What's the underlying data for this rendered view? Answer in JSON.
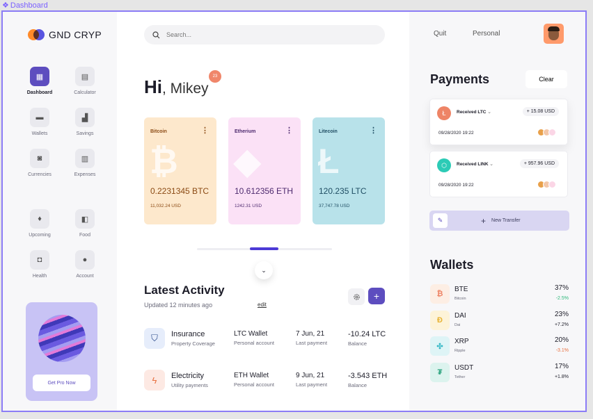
{
  "frame_label": "Dashboard",
  "brand": {
    "name": "GND CRYP"
  },
  "nav": {
    "group1": [
      {
        "label": "Dashboard",
        "icon": "dashboard-icon",
        "glyph": "▦",
        "active": true
      },
      {
        "label": "Calculator",
        "icon": "calculator-icon",
        "glyph": "▤",
        "active": false
      },
      {
        "label": "Wallets",
        "icon": "wallet-icon",
        "glyph": "▬",
        "active": false
      },
      {
        "label": "Savings",
        "icon": "savings-icon",
        "glyph": "▟",
        "active": false
      },
      {
        "label": "Currencies",
        "icon": "currencies-icon",
        "glyph": "◙",
        "active": false
      },
      {
        "label": "Expenses",
        "icon": "expenses-icon",
        "glyph": "▥",
        "active": false
      }
    ],
    "group2": [
      {
        "label": "Upcoming",
        "icon": "fire-icon",
        "glyph": "♦",
        "active": false
      },
      {
        "label": "Food",
        "icon": "food-icon",
        "glyph": "◧",
        "active": false
      },
      {
        "label": "Health",
        "icon": "health-icon",
        "glyph": "◘",
        "active": false
      },
      {
        "label": "Account",
        "icon": "account-icon",
        "glyph": "●",
        "active": false
      }
    ]
  },
  "promo": {
    "button": "Get Pro Now"
  },
  "search": {
    "placeholder": "Search..."
  },
  "greeting": {
    "hi": "Hi",
    "name": ", Mikey",
    "badge": "23"
  },
  "coins": [
    {
      "name": "Bitcoin",
      "amount": "0.2231345 BTC",
      "usd": "11,032.24 USD",
      "symbol": "₿",
      "bg": "#fde8cc",
      "fg": "#8b4a14",
      "icon": "bitcoin-icon"
    },
    {
      "name": "Etherium",
      "amount": "10.612356  ETH",
      "usd": "1242.31 USD",
      "symbol": "◆",
      "bg": "#fbe1f6",
      "fg": "#4d2a6e",
      "icon": "ethereum-icon"
    },
    {
      "name": "Litecoin",
      "amount": "120.235 LTC",
      "usd": "37,747.78 USD",
      "symbol": "Ł",
      "bg": "#b8e2ea",
      "fg": "#1f4d63",
      "icon": "litecoin-icon"
    }
  ],
  "activity": {
    "title": "Latest Activity",
    "subtitle": "Updated 12 minutes ago",
    "edit": "edit",
    "rows": [
      {
        "title": "Insurance",
        "sub": "Property Coverage",
        "wallet": "LTC Wallet",
        "wallet_sub": "Personal account",
        "date": "7 Jun, 21",
        "date_sub": "Last payment",
        "amount": "-10.24 LTC",
        "amount_sub": "Balance",
        "icon": "shield-icon",
        "glyph": "⛉",
        "bg": "#e6edfb",
        "fg": "#2b4a8a"
      },
      {
        "title": "Electricity",
        "sub": "Utility payments",
        "wallet": "ETH Wallet",
        "wallet_sub": "Personal account",
        "date": "9 Jun, 21",
        "date_sub": "Last payment",
        "amount": "-3.543 ETH",
        "amount_sub": "Balance",
        "icon": "lightning-icon",
        "glyph": "ϟ",
        "bg": "#fde9e3",
        "fg": "#e8703f"
      }
    ]
  },
  "header_right": {
    "quit": "Quit",
    "personal": "Personal"
  },
  "payments": {
    "title": "Payments",
    "clear": "Clear",
    "items": [
      {
        "label": "Received LTC",
        "amount": "+ 15.08 USD",
        "date": "09/28/2020 19:22",
        "icon": "litecoin-icon",
        "glyph": "Ł",
        "color": "#ee8466"
      },
      {
        "label": "Received LINK",
        "amount": "+ 957.96 USD",
        "date": "09/28/2020 19:22",
        "icon": "chainlink-icon",
        "glyph": "⬡",
        "color": "#2ccbb6"
      }
    ],
    "transfer": "New Transfer"
  },
  "wallets": {
    "title": "Wallets",
    "items": [
      {
        "name": "BTE",
        "sub": "Bitcoin",
        "pct": "37%",
        "change": "-2.5%",
        "glyph": "₿",
        "icon": "bitcoin-icon",
        "bg": "#fdeee4",
        "fg": "#ee8466",
        "change_color": "#2db87a"
      },
      {
        "name": "DAI",
        "sub": "Dai",
        "pct": "23%",
        "change": "+7.2%",
        "glyph": "Đ",
        "icon": "dai-icon",
        "bg": "#fdf3d8",
        "fg": "#e7b232",
        "change_color": "#1c1c28"
      },
      {
        "name": "XRP",
        "sub": "Ripple",
        "pct": "20%",
        "change": "-3.1%",
        "glyph": "✣",
        "icon": "ripple-icon",
        "bg": "#def4f6",
        "fg": "#32b7c5",
        "change_color": "#e8703f"
      },
      {
        "name": "USDT",
        "sub": "Tether",
        "pct": "17%",
        "change": "+1.8%",
        "glyph": "₮",
        "icon": "tether-icon",
        "bg": "#dcf3ee",
        "fg": "#26a17b",
        "change_color": "#1c1c28"
      }
    ]
  }
}
